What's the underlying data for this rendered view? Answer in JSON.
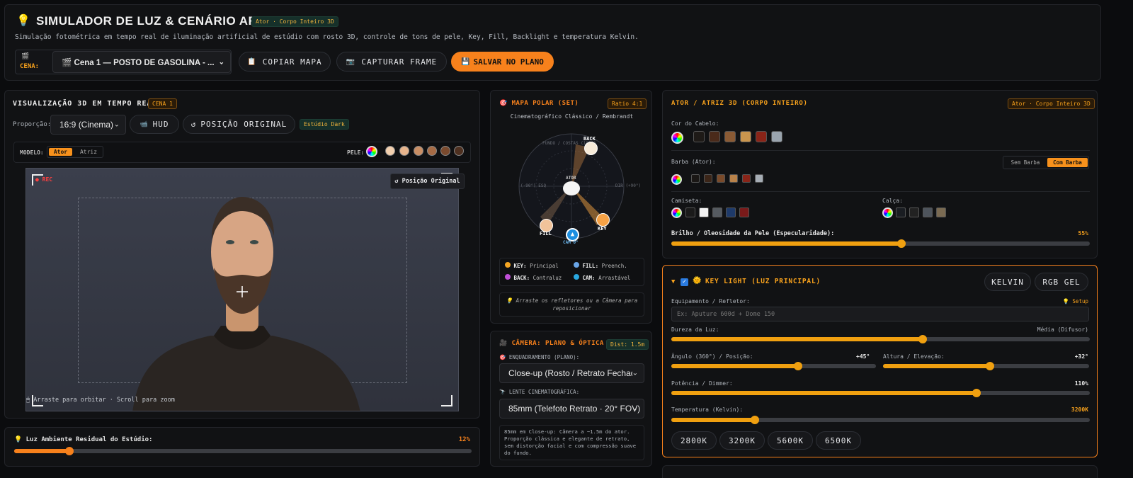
{
  "header": {
    "title": "SIMULADOR DE LUZ & CENÁRIO ARTIFICIAL 3D",
    "badge": "Ator · Corpo Inteiro 3D",
    "subtitle": "Simulação fotométrica em tempo real de iluminação artificial de estúdio com rosto 3D, controle de tons de pele, Key, Fill, Backlight e temperatura Kelvin.",
    "scene_label": "CENA:",
    "scene_value": "🎬 Cena 1 — POSTO DE GASOLINA - ...",
    "copy_map": "COPIAR MAPA",
    "capture_frame": "CAPTURAR FRAME",
    "save_plan": "SALVAR NO PLANO"
  },
  "viewport": {
    "title": "VISUALIZAÇÃO 3D EM TEMPO REAL",
    "scene_badge": "CENA 1",
    "ratio_label": "Proporção:",
    "ratio_value": "16:9 (Cinema)",
    "hud": "HUD",
    "reset": "POSIÇÃO ORIGINAL",
    "studio_badge": "Estúdio Dark",
    "model_label": "MODELO:",
    "model_actor": "Ator",
    "model_actress": "Atriz",
    "skin_label": "PELE:",
    "rec": "REC",
    "reset_overlay": "↺ Posição Original",
    "hint": "Arraste para orbitar · Scroll para zoom"
  },
  "ambient": {
    "label": "Luz Ambiente Residual do Estúdio:",
    "value_text": "12%",
    "value": 0.12
  },
  "polar": {
    "title": "MAPA POLAR (SET)",
    "ratio_badge": "Ratio 4:1",
    "subtitle": "Cinematográfico Clássico / Rembrandt",
    "bg_label": "FUNDO / COSTAS (180°)",
    "left_label": "(-90°) ESQ",
    "right_label": "DIR (+90°)",
    "actor_label": "ATOR",
    "back": "BACK",
    "fill": "FILL",
    "key": "KEY",
    "cam": "CAM 0°",
    "legend": [
      {
        "name": "KEY:",
        "desc": "Principal",
        "color": "#f5a623"
      },
      {
        "name": "FILL:",
        "desc": "Preench.",
        "color": "#6aa6e8"
      },
      {
        "name": "BACK:",
        "desc": "Contraluz",
        "color": "#c04fd8"
      },
      {
        "name": "CAM:",
        "desc": "Arrastável",
        "color": "#29a8e0"
      }
    ],
    "drag_hint": "Arraste os refletores ou a Câmera para reposicionar"
  },
  "camera": {
    "title": "CÂMERA: PLANO & ÓPTICA",
    "dist_badge": "Dist: 1.5m",
    "framing_label": "ENQUADRAMENTO (PLANO):",
    "framing_value": "Close-up (Rosto / Retrato Fechado)",
    "lens_label": "LENTE CINEMATOGRÁFICA:",
    "lens_value": "85mm (Telefoto Retrato · 20° FOV)",
    "note": "85mm em Close-up: Câmera a ~1.5m do ator. Proporção clássica e elegante de retrato, sem distorção facial e com compressão suave do fundo."
  },
  "actor": {
    "title": "ATOR / ATRIZ 3D (CORPO INTEIRO)",
    "badge": "Ator · Corpo Inteiro 3D",
    "hair_label": "Cor do Cabelo:",
    "hair_colors": [
      "#1e1a17",
      "#4a2a1a",
      "#8a5a34",
      "#c9954e",
      "#8a2418",
      "#9aa4ae"
    ],
    "beard_label": "Barba (Ator):",
    "beard_colors": [
      "#1a1715",
      "#3b2518",
      "#7a4a2a",
      "#b9824a",
      "#8a2418",
      "#a6adb5"
    ],
    "no_beard": "Sem Barba",
    "with_beard": "Com Barba",
    "shirt_label": "Camiseta:",
    "shirt_colors": [
      "#1a1a1a",
      "#f2f2f2",
      "#555a60",
      "#1e3a6a",
      "#7a1a1a"
    ],
    "pants_label": "Calça:",
    "pants_colors": [
      "#1a1d22",
      "#222",
      "#4e545c",
      "#7a6a52"
    ],
    "shine_label": "Brilho / Oleosidade da Pele (Especularidade):",
    "shine_text": "55%",
    "shine": 0.55
  },
  "skin_tones": [
    "#f2cfae",
    "#e7b48c",
    "#c98e64",
    "#a66b45",
    "#7a4a2e",
    "#4e3020"
  ],
  "key_light": {
    "title": "KEY LIGHT (LUZ PRINCIPAL)",
    "kelvin_btn": "KELVIN",
    "rgb_btn": "RGB GEL",
    "equip_label": "Equipamento / Refletor:",
    "setup": "💡 Setup",
    "equip_placeholder": "Ex: Aputure 600d + Dome 150",
    "hardness_label": "Dureza da Luz:",
    "hardness_text": "Média (Difusor)",
    "hardness": 0.6,
    "angle_label": "Ângulo (360°) / Posição:",
    "angle_text": "+45°",
    "angle": 0.62,
    "height_label": "Altura / Elevação:",
    "height_text": "+32°",
    "height": 0.52,
    "power_label": "Potência / Dimmer:",
    "power_text": "110%",
    "power": 0.73,
    "temp_label": "Temperatura (Kelvin):",
    "temp_text": "3200K",
    "temp": 0.2,
    "presets": [
      "2800K",
      "3200K",
      "5600K",
      "6500K"
    ]
  }
}
